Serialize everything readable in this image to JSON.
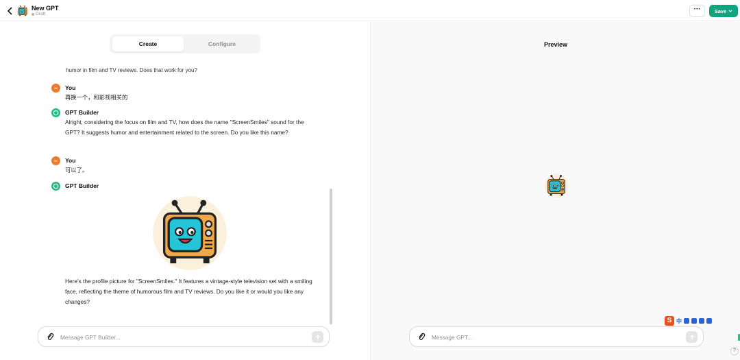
{
  "header": {
    "title": "New GPT",
    "status": "Draft",
    "more_label": "···",
    "save_label": "Save"
  },
  "tabs": [
    {
      "label": "Create",
      "active": true
    },
    {
      "label": "Configure",
      "active": false
    }
  ],
  "chat": {
    "cut_line": "humor in film and TV reviews. Does that work for you?",
    "messages": [
      {
        "sender": "You",
        "avatar_text": "SK",
        "text": "再换一个，和影视相关的"
      },
      {
        "sender": "GPT Builder",
        "text": "Alright, considering the focus on film and TV, how does the name \"ScreenSmiles\" sound for the GPT? It suggests humor and entertainment related to the screen. Do you like this name?"
      },
      {
        "sender": "You",
        "avatar_text": "SK",
        "text": "可以了。"
      },
      {
        "sender": "GPT Builder",
        "text": ""
      },
      {
        "sender": "",
        "text": "Here's the profile picture for \"ScreenSmiles.\" It features a vintage-style television set with a smiling face, reflecting the theme of humorous film and TV reviews. Do you like it or would you like any changes?"
      }
    ]
  },
  "builder_input": {
    "placeholder": "Message GPT Builder..."
  },
  "preview": {
    "title": "Preview",
    "input_placeholder": "Message GPT...",
    "help_label": "?"
  },
  "ime": {
    "logo": "S",
    "mode": "中"
  },
  "colors": {
    "accent": "#10a37f",
    "user_avatar": "#e87c2c",
    "bot_avatar": "#19c37d"
  },
  "icons": [
    "back-chevron-icon",
    "tv-logo-icon",
    "chevron-down-icon",
    "paperclip-icon",
    "arrow-up-icon",
    "gpt-builder-icon"
  ]
}
